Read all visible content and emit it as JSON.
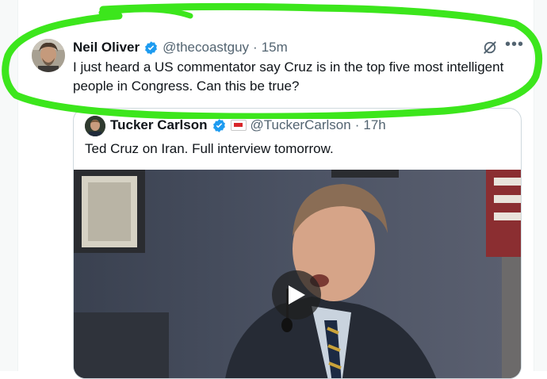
{
  "post": {
    "author_name": "Neil Oliver",
    "handle": "@thecoastguy",
    "separator": "·",
    "time": "15m",
    "text": "I just heard a US commentator say Cruz is in the top five most intelligent people in Congress. Can this be true?",
    "more_label": "•••"
  },
  "quoted": {
    "author_name": "Tucker Carlson",
    "handle": "@TuckerCarlson",
    "separator": "·",
    "time": "17h",
    "text": "Ted Cruz on Iran. Full interview tomorrow."
  },
  "colors": {
    "verified_blue": "#1d9bf0",
    "highlight_green": "#3ce61c",
    "secondary_text": "#536471"
  },
  "icons": [
    "verified-badge-icon",
    "grok-icon",
    "more-icon",
    "play-icon",
    "tcn-affiliate-badge-icon"
  ]
}
